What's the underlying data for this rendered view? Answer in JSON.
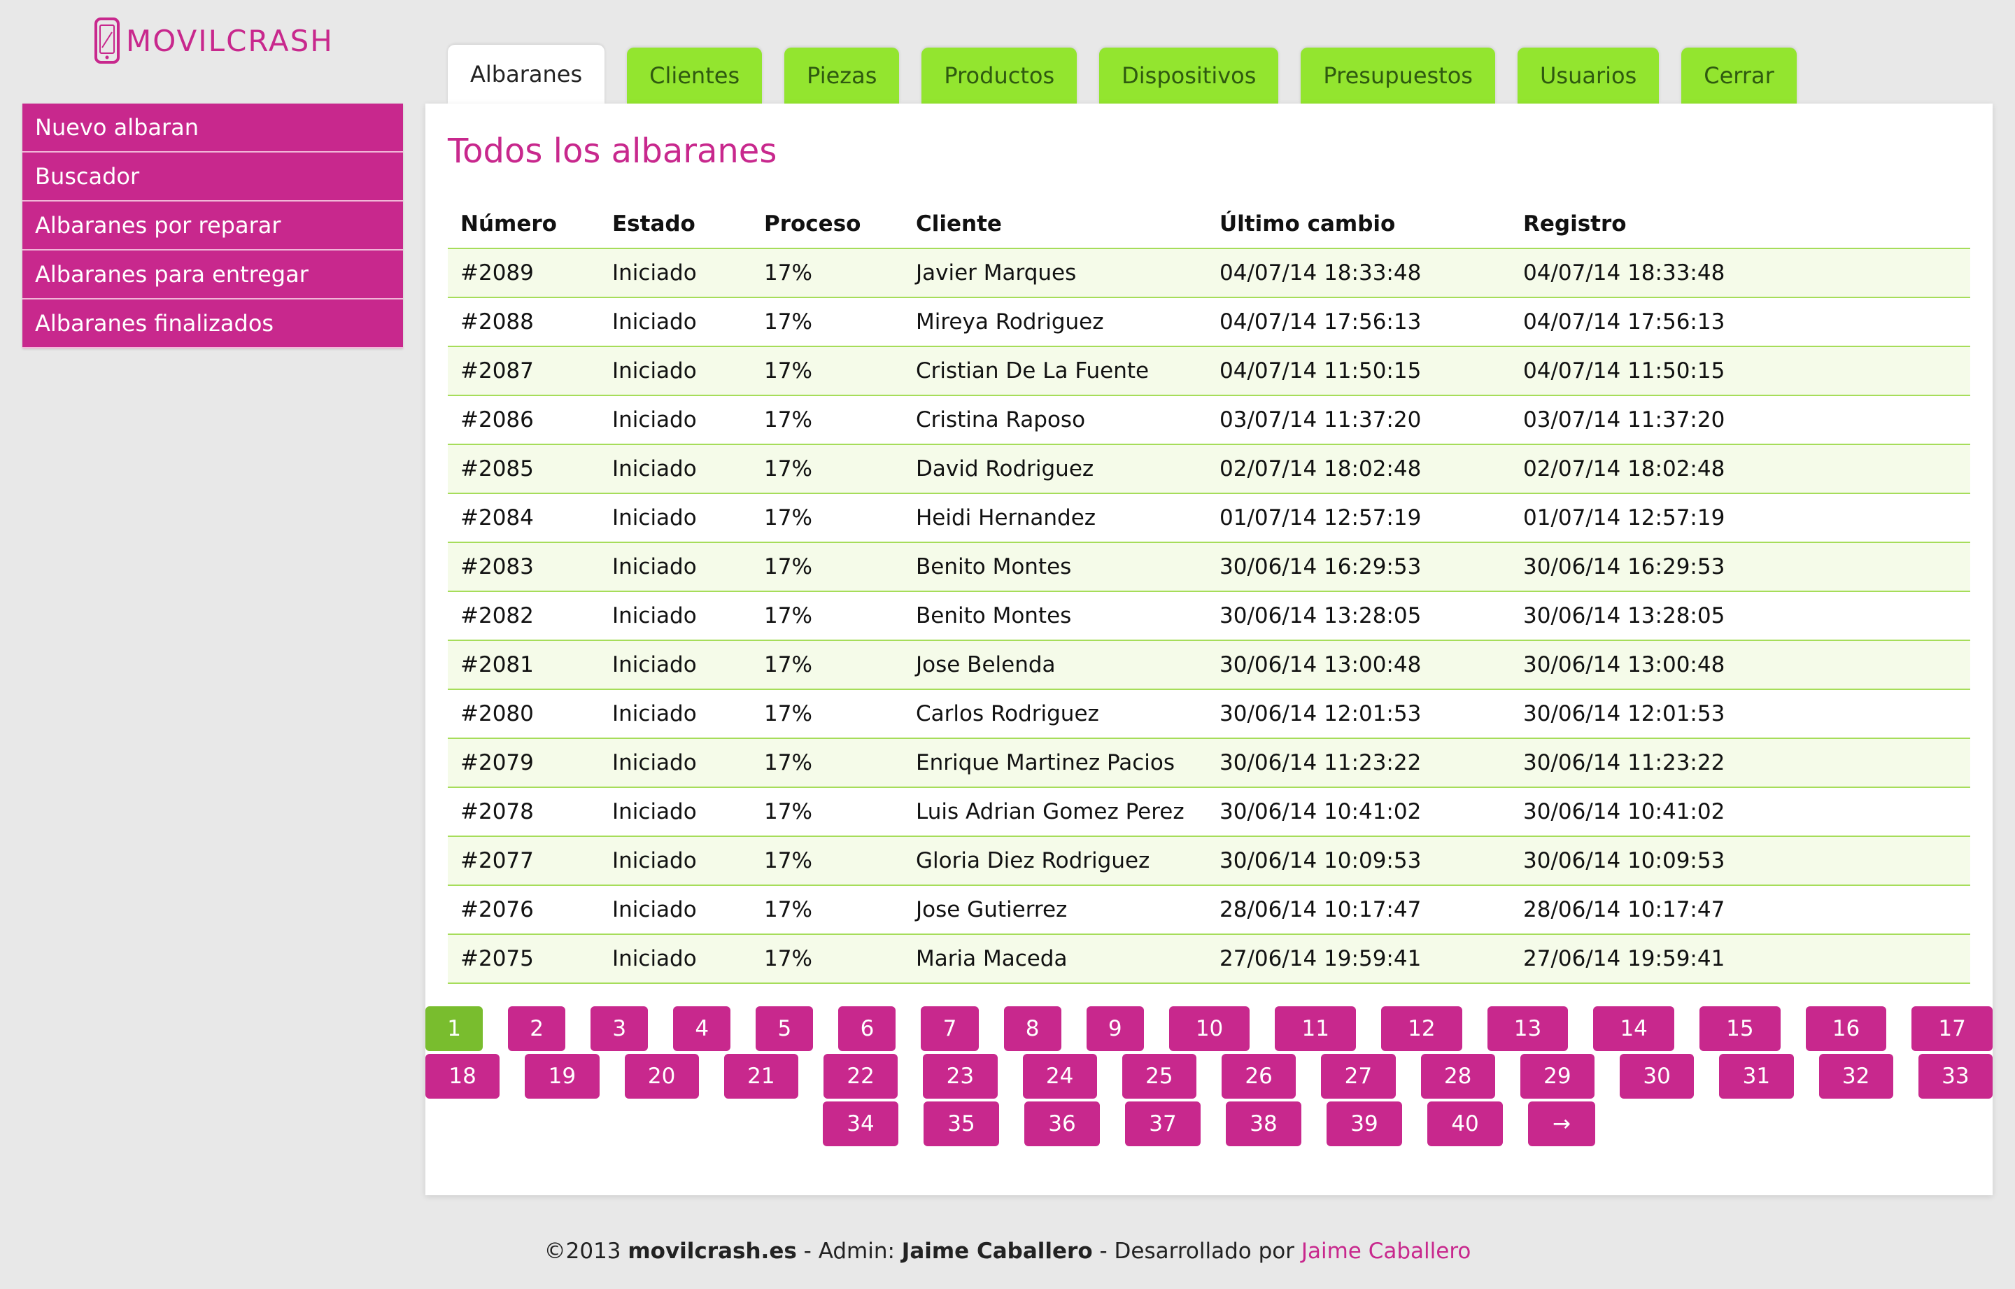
{
  "brand": {
    "name": "MOVILCRASH"
  },
  "tabs": [
    {
      "label": "Albaranes",
      "active": true
    },
    {
      "label": "Clientes"
    },
    {
      "label": "Piezas"
    },
    {
      "label": "Productos"
    },
    {
      "label": "Dispositivos"
    },
    {
      "label": "Presupuestos"
    },
    {
      "label": "Usuarios"
    },
    {
      "label": "Cerrar"
    }
  ],
  "sidebar": {
    "items": [
      {
        "label": "Nuevo albaran"
      },
      {
        "label": "Buscador"
      },
      {
        "label": "Albaranes por reparar"
      },
      {
        "label": "Albaranes para entregar"
      },
      {
        "label": "Albaranes finalizados"
      }
    ]
  },
  "main": {
    "title": "Todos los albaranes",
    "columns": [
      "Número",
      "Estado",
      "Proceso",
      "Cliente",
      "Último cambio",
      "Registro"
    ],
    "rows": [
      [
        "#2089",
        "Iniciado",
        "17%",
        "Javier Marques",
        "04/07/14 18:33:48",
        "04/07/14 18:33:48"
      ],
      [
        "#2088",
        "Iniciado",
        "17%",
        "Mireya Rodriguez",
        "04/07/14 17:56:13",
        "04/07/14 17:56:13"
      ],
      [
        "#2087",
        "Iniciado",
        "17%",
        "Cristian De La Fuente",
        "04/07/14 11:50:15",
        "04/07/14 11:50:15"
      ],
      [
        "#2086",
        "Iniciado",
        "17%",
        "Cristina Raposo",
        "03/07/14 11:37:20",
        "03/07/14 11:37:20"
      ],
      [
        "#2085",
        "Iniciado",
        "17%",
        "David Rodriguez",
        "02/07/14 18:02:48",
        "02/07/14 18:02:48"
      ],
      [
        "#2084",
        "Iniciado",
        "17%",
        "Heidi Hernandez",
        "01/07/14 12:57:19",
        "01/07/14 12:57:19"
      ],
      [
        "#2083",
        "Iniciado",
        "17%",
        "Benito Montes",
        "30/06/14 16:29:53",
        "30/06/14 16:29:53"
      ],
      [
        "#2082",
        "Iniciado",
        "17%",
        "Benito Montes",
        "30/06/14 13:28:05",
        "30/06/14 13:28:05"
      ],
      [
        "#2081",
        "Iniciado",
        "17%",
        "Jose Belenda",
        "30/06/14 13:00:48",
        "30/06/14 13:00:48"
      ],
      [
        "#2080",
        "Iniciado",
        "17%",
        "Carlos Rodriguez",
        "30/06/14 12:01:53",
        "30/06/14 12:01:53"
      ],
      [
        "#2079",
        "Iniciado",
        "17%",
        "Enrique Martinez Pacios",
        "30/06/14 11:23:22",
        "30/06/14 11:23:22"
      ],
      [
        "#2078",
        "Iniciado",
        "17%",
        "Luis Adrian Gomez Perez",
        "30/06/14 10:41:02",
        "30/06/14 10:41:02"
      ],
      [
        "#2077",
        "Iniciado",
        "17%",
        "Gloria Diez Rodriguez",
        "30/06/14 10:09:53",
        "30/06/14 10:09:53"
      ],
      [
        "#2076",
        "Iniciado",
        "17%",
        "Jose Gutierrez",
        "28/06/14 10:17:47",
        "28/06/14 10:17:47"
      ],
      [
        "#2075",
        "Iniciado",
        "17%",
        "Maria Maceda",
        "27/06/14 19:59:41",
        "27/06/14 19:59:41"
      ]
    ]
  },
  "pagination": {
    "current": "1",
    "rows": [
      [
        "1",
        "2",
        "3",
        "4",
        "5",
        "6",
        "7",
        "8",
        "9",
        "10",
        "11",
        "12",
        "13",
        "14",
        "15",
        "16",
        "17"
      ],
      [
        "18",
        "19",
        "20",
        "21",
        "22",
        "23",
        "24",
        "25",
        "26",
        "27",
        "28",
        "29",
        "30",
        "31",
        "32",
        "33"
      ],
      [
        "34",
        "35",
        "36",
        "37",
        "38",
        "39",
        "40",
        "→"
      ]
    ]
  },
  "footer": {
    "copyright": "©2013 ",
    "site": "movilcrash.es",
    "admin_prefix": " - Admin: ",
    "admin_name": "Jaime Caballero",
    "dev_prefix": " - Desarrollado por ",
    "dev_name": "Jaime Caballero"
  },
  "colors": {
    "accent": "#c8288d",
    "tab": "#93e52f",
    "current_page": "#79bd2e",
    "row_alt": "#f5fbe9",
    "border": "#a6dd5a"
  }
}
